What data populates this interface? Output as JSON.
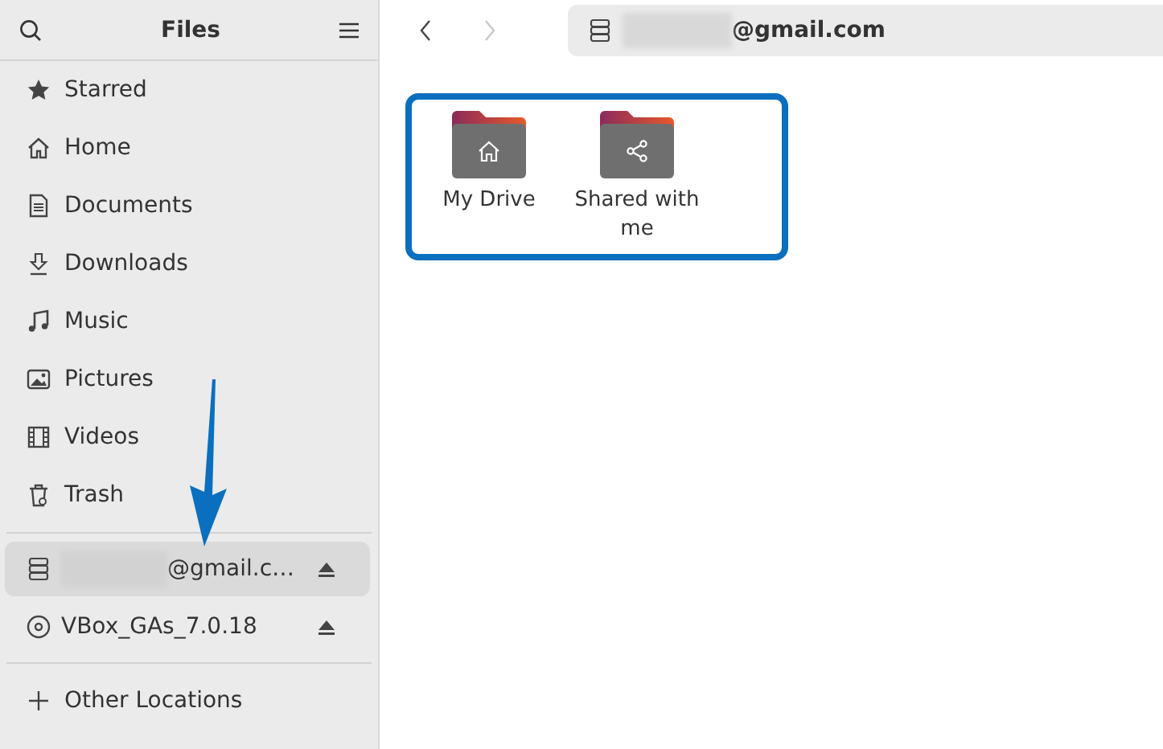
{
  "window": {
    "title": "Files"
  },
  "sidebar": {
    "places": [
      {
        "label": "Starred"
      },
      {
        "label": "Home"
      },
      {
        "label": "Documents"
      },
      {
        "label": "Downloads"
      },
      {
        "label": "Music"
      },
      {
        "label": "Pictures"
      },
      {
        "label": "Videos"
      },
      {
        "label": "Trash"
      }
    ],
    "devices": [
      {
        "label": "@gmail.c…",
        "redacted": true,
        "selected": true,
        "eject": true
      },
      {
        "label": "VBox_GAs_7.0.18",
        "redacted": false,
        "selected": false,
        "eject": true
      }
    ],
    "other": {
      "label": "Other Locations"
    }
  },
  "nav": {
    "back_disabled": false,
    "forward_disabled": true
  },
  "path_bar": {
    "location": "@gmail.com",
    "redacted": true
  },
  "files": [
    {
      "name": "My Drive"
    },
    {
      "name": "Shared with me"
    }
  ],
  "annotations": {
    "arrow": true,
    "highlight_box": true
  }
}
